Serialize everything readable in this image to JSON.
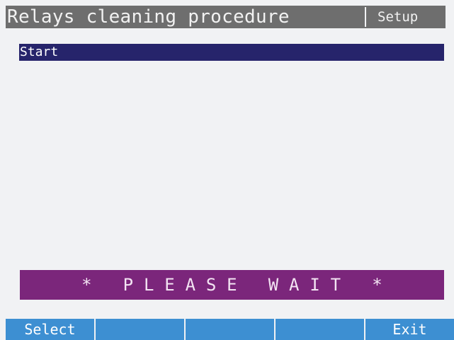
{
  "title": "Relays cleaning procedure",
  "mode": "Setup",
  "list": {
    "items": [
      {
        "label": "Start",
        "selected": true
      }
    ]
  },
  "status_banner": "*   P L E A S E   W A I T   *",
  "softkeys": [
    "Select",
    "",
    "",
    "",
    "Exit"
  ],
  "colors": {
    "title_bar": "#6e6e6e",
    "screen_bg": "#f1f2f4",
    "selection": "#26246b",
    "banner": "#7b267b",
    "softkey_bar": "#3d8fd2"
  }
}
